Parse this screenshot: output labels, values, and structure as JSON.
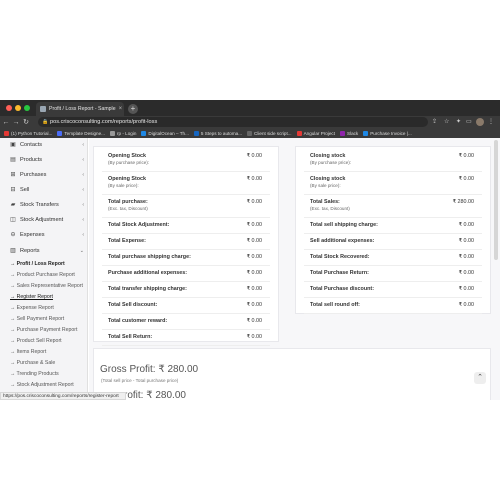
{
  "browser": {
    "tab_title": "Profit / Loss Report - Sample",
    "tab_close": "×",
    "new_tab": "+",
    "url": "pos.criscoconsulting.com/reports/profit-loss",
    "bookmarks": [
      {
        "label": "(1) Python Tutorial...",
        "color": "#e53935"
      },
      {
        "label": "Template Designe...",
        "color": "#4a6cf7"
      },
      {
        "label": "rp - Login",
        "color": "#999999"
      },
      {
        "label": "DigitalOcean – Th...",
        "color": "#1e88e5"
      },
      {
        "label": "5 Steps to automa...",
        "color": "#1565c0"
      },
      {
        "label": "Client side script...",
        "color": "#666666"
      },
      {
        "label": "Angular Project",
        "color": "#e53935"
      },
      {
        "label": "Slack",
        "color": "#8e24aa"
      },
      {
        "label": "Purchase Invoice |...",
        "color": "#1e88e5"
      }
    ],
    "status_url": "https://pos.criscoconsulting.com/reports/register-report"
  },
  "sidebar": {
    "items": [
      {
        "label": "Contacts",
        "icon": "contacts-icon"
      },
      {
        "label": "Products",
        "icon": "products-icon"
      },
      {
        "label": "Purchases",
        "icon": "purchases-icon"
      },
      {
        "label": "Sell",
        "icon": "sell-icon"
      },
      {
        "label": "Stock Transfers",
        "icon": "truck-icon"
      },
      {
        "label": "Stock Adjustment",
        "icon": "adjustment-icon"
      },
      {
        "label": "Expenses",
        "icon": "expenses-icon"
      },
      {
        "label": "Reports",
        "icon": "reports-icon"
      }
    ],
    "sub_items": [
      "→ Profit / Loss Report",
      "→ Product Purchase Report",
      "→ Sales Representative Report",
      "→ Register Report",
      "→ Expense Report",
      "→ Sell Payment Report",
      "→ Purchase Payment Report",
      "→ Product Sell Report",
      "→ Items Report",
      "→ Purchase & Sale",
      "→ Trending Products",
      "→ Stock Adjustment Report"
    ]
  },
  "left_card": {
    "rows": [
      {
        "label": "Opening Stock",
        "sub": "(By purchase price):",
        "value": "₹ 0.00"
      },
      {
        "label": "Opening Stock",
        "sub": "(By sale price):",
        "value": "₹ 0.00"
      },
      {
        "label": "Total purchase:",
        "sub": "(Exc. tax, Discount)",
        "value": "₹ 0.00"
      },
      {
        "label": "Total Stock Adjustment:",
        "sub": "",
        "value": "₹ 0.00"
      },
      {
        "label": "Total Expense:",
        "sub": "",
        "value": "₹ 0.00"
      },
      {
        "label": "Total purchase shipping charge:",
        "sub": "",
        "value": "₹ 0.00"
      },
      {
        "label": "Purchase additional expenses:",
        "sub": "",
        "value": "₹ 0.00"
      },
      {
        "label": "Total transfer shipping charge:",
        "sub": "",
        "value": "₹ 0.00"
      },
      {
        "label": "Total Sell discount:",
        "sub": "",
        "value": "₹ 0.00"
      },
      {
        "label": "Total customer reward:",
        "sub": "",
        "value": "₹ 0.00"
      },
      {
        "label": "Total Sell Return:",
        "sub": "",
        "value": "₹ 0.00"
      }
    ]
  },
  "right_card": {
    "rows": [
      {
        "label": "Closing stock",
        "sub": "(By purchase price):",
        "value": "₹ 0.00"
      },
      {
        "label": "Closing stock",
        "sub": "(By sale price):",
        "value": "₹ 0.00"
      },
      {
        "label": "Total Sales:",
        "sub": "(Exc. tax, Discount)",
        "value": "₹ 280.00"
      },
      {
        "label": "Total sell shipping charge:",
        "sub": "",
        "value": "₹ 0.00"
      },
      {
        "label": "Sell additional expenses:",
        "sub": "",
        "value": "₹ 0.00"
      },
      {
        "label": "Total Stock Recovered:",
        "sub": "",
        "value": "₹ 0.00"
      },
      {
        "label": "Total Purchase Return:",
        "sub": "",
        "value": "₹ 0.00"
      },
      {
        "label": "Total Purchase discount:",
        "sub": "",
        "value": "₹ 0.00"
      },
      {
        "label": "Total sell round off:",
        "sub": "",
        "value": "₹ 0.00"
      }
    ]
  },
  "summary": {
    "gross_profit": "Gross Profit: ₹ 280.00",
    "gross_note": "(Total sell price - Total purchase price)",
    "net_profit": "rofit: ₹ 280.00"
  },
  "colors": {
    "accent": "#e53935",
    "sidebar_bg": "#f4f4f6",
    "card_border": "#e8e8ec"
  }
}
